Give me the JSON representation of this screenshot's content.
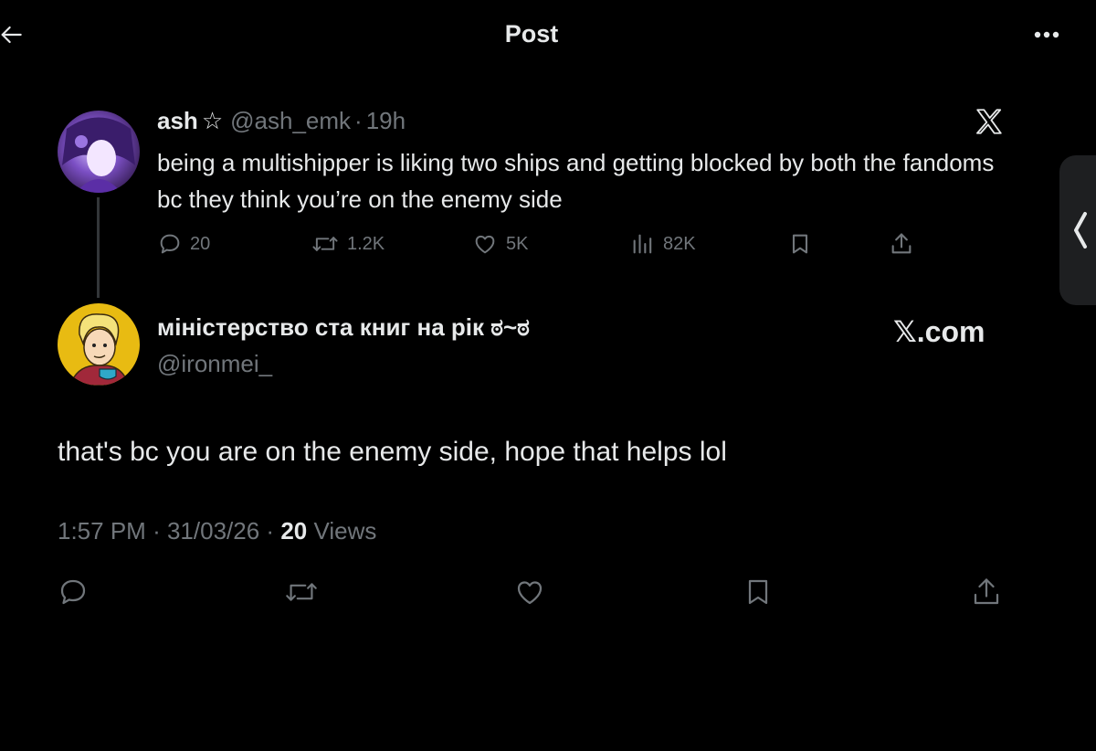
{
  "header": {
    "title": "Post",
    "back_icon": "arrow-left-icon",
    "more_icon": "more-horizontal-icon"
  },
  "quoted_post": {
    "display_name": "ash",
    "name_suffix": "☆",
    "handle": "@ash_emk",
    "separator": "·",
    "time": "19h",
    "text": "being a multishipper is liking two ships and getting blocked by both the fandoms bc they think you’re on the enemy side",
    "source_icon": "x-logo-icon",
    "stats": {
      "replies": "20",
      "reposts": "1.2K",
      "likes": "5K",
      "views": "82K"
    }
  },
  "side_tab": {
    "icon": "chevron-left-icon"
  },
  "reply_post": {
    "display_name": "міністерство ста книг на рік ಠ~ಠ",
    "handle": "@ironmei_",
    "source_label": "𝕏.com",
    "text": "that's bc you are on the enemy side, hope that helps lol",
    "time": "1:57 PM",
    "date": "31/03/26",
    "views_count": "20",
    "views_label": "Views",
    "separator": "·"
  },
  "colors": {
    "background": "#000000",
    "primary_text": "#e7e9ea",
    "secondary_text": "#71767b",
    "divider": "#333639"
  }
}
